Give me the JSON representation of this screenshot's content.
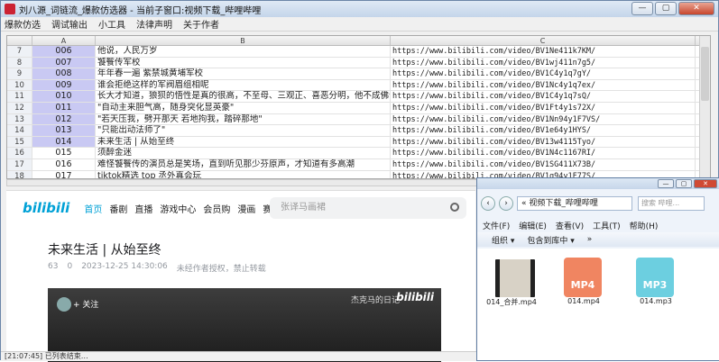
{
  "window": {
    "title": "刘八源_词链流_爆款仿选器 - 当前子窗口:视频下载_哔哩哔哩",
    "controls": {
      "minimize": "—",
      "maximize": "▢",
      "close": "✕"
    }
  },
  "menubar": [
    "爆款仿选",
    "调试输出",
    "小工具",
    "法律声明",
    "关于作者"
  ],
  "grid": {
    "columns": [
      "",
      "A",
      "B",
      "C"
    ],
    "rows": [
      {
        "rn": "7",
        "a": "006",
        "b": "他说，人民万岁",
        "c": "https://www.bilibili.com/video/BV1Ne411k7KM/"
      },
      {
        "rn": "8",
        "a": "007",
        "b": "饕餮传军校",
        "c": "https://www.bilibili.com/video/BV1wj411n7g5/"
      },
      {
        "rn": "9",
        "a": "008",
        "b": "年年春一遍 紫禁城黄埔军校",
        "c": "https://www.bilibili.com/video/BV1C4y1q7gY/"
      },
      {
        "rn": "10",
        "a": "009",
        "b": "谁会拒绝这样的军阀眉组相呢",
        "c": "https://www.bilibili.com/video/BV1Nc4y1q7ex/"
      },
      {
        "rn": "11",
        "a": "010",
        "b": "长大才知道，狼狈的悟性是真的很高，不至母、三观正、喜恶分明，他不成佛谁成佛。",
        "c": "https://www.bilibili.com/video/BV1C4y1q7sQ/"
      },
      {
        "rn": "12",
        "a": "011",
        "b": "\"自动主来胆气高，随身突化显英豪\"",
        "c": "https://www.bilibili.com/video/BV1Ft4y1s72X/"
      },
      {
        "rn": "13",
        "a": "012",
        "b": "\"若天压我，劈开那天 若地拘我，踏碎那地\"",
        "c": "https://www.bilibili.com/video/BV1Nn94y1F7VS/"
      },
      {
        "rn": "14",
        "a": "013",
        "b": "\"只能出动法师了\"",
        "c": "https://www.bilibili.com/video/BV1e64y1HYS/"
      },
      {
        "rn": "15",
        "a": "014",
        "b": "未来生活 | 从始至终",
        "c": "https://www.bilibili.com/video/BV13w4115Tyo/"
      },
      {
        "rn": "16",
        "a": "015",
        "b": "须醉金迷",
        "c": "https://www.bilibili.com/video/BV1N4c1167RI/"
      },
      {
        "rn": "17",
        "a": "016",
        "b": "难怪饕餮传的演员总是笑场，直到听见那少芬原声，才知道有多高潮",
        "c": "https://www.bilibili.com/video/BV1SG411X73B/"
      },
      {
        "rn": "18",
        "a": "017",
        "b": "tiktok精选  top 丞外真会玩",
        "c": "https://www.bilibili.com/video/BV1q94y1F77S/"
      }
    ]
  },
  "browser": {
    "logo": "bilibili",
    "nav": [
      "首页",
      "番剧",
      "直播",
      "游戏中心",
      "会员购",
      "漫画",
      "赛事"
    ],
    "search_placeholder": "张译马画裙",
    "video_title": "未来生活 | 从始至终",
    "meta": {
      "views": "63",
      "danmaku": "0",
      "date": "2023-12-25 14:30:06",
      "copyright": "未经作者授权，禁止转载"
    },
    "player": {
      "follow": "+ 关注",
      "owner": "杰克马的日记",
      "watermark": "bilibili"
    }
  },
  "statusbar": "[21:07:45] 已列表结束…",
  "explorer": {
    "address": "« 视频下载_哔哩哔哩",
    "search": "搜索 哔哩...",
    "menu": [
      "文件(F)",
      "编辑(E)",
      "查看(V)",
      "工具(T)",
      "帮助(H)"
    ],
    "toolbar": [
      "组织 ▾",
      "包含到库中 ▾",
      "»"
    ],
    "files": [
      {
        "name": "014_合并.mp4",
        "kind": "video"
      },
      {
        "name": "014.mp4",
        "kind": "MP4"
      },
      {
        "name": "014.mp3",
        "kind": "MP3"
      }
    ]
  },
  "colors": {
    "accent": "#00a1d6",
    "selected_col": "#c9c9f3",
    "mp4": "#f08561",
    "mp3": "#6ccfe0"
  }
}
